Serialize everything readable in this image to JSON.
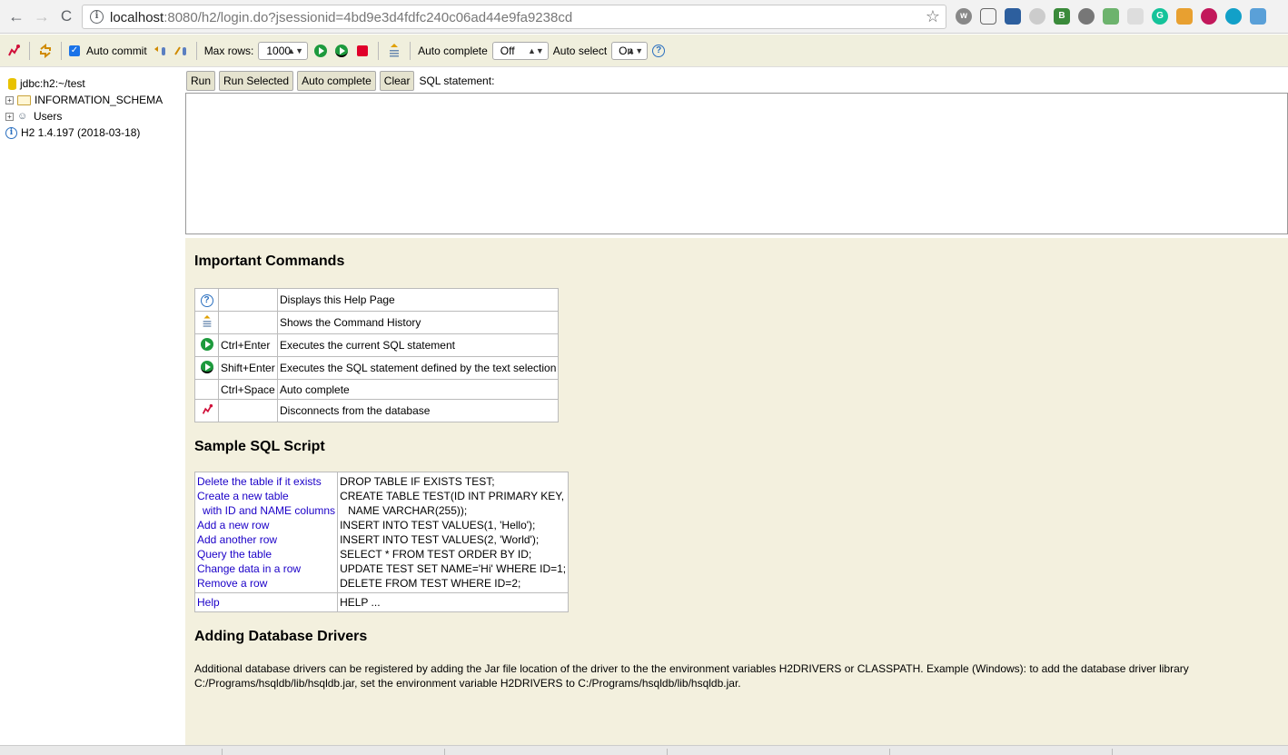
{
  "browser": {
    "url_host": "localhost",
    "url_rest": ":8080/h2/login.do?jsessionid=4bd9e3d4fdfc240c06ad44e9fa9238cd",
    "back_icon": "←",
    "forward_icon": "→",
    "reload_icon": "C",
    "star_icon": "☆"
  },
  "toolbar": {
    "auto_commit_label": "Auto commit",
    "max_rows_label": "Max rows:",
    "max_rows_value": "1000",
    "auto_complete_label": "Auto complete",
    "auto_complete_value": "Off",
    "auto_select_label": "Auto select",
    "auto_select_value": "On"
  },
  "tree": {
    "connection": "jdbc:h2:~/test",
    "schema": "INFORMATION_SCHEMA",
    "users": "Users",
    "version": "H2 1.4.197 (2018-03-18)"
  },
  "sql": {
    "run": "Run",
    "run_selected": "Run Selected",
    "auto_complete": "Auto complete",
    "clear": "Clear",
    "statement_label": "SQL statement:"
  },
  "help": {
    "important_title": "Important Commands",
    "commands": [
      {
        "key": "",
        "desc": "Displays this Help Page"
      },
      {
        "key": "",
        "desc": "Shows the Command History"
      },
      {
        "key": "Ctrl+Enter",
        "desc": "Executes the current SQL statement"
      },
      {
        "key": "Shift+Enter",
        "desc": "Executes the SQL statement defined by the text selection"
      },
      {
        "key": "Ctrl+Space",
        "desc": "Auto complete"
      },
      {
        "key": "",
        "desc": "Disconnects from the database"
      }
    ],
    "sample_title": "Sample SQL Script",
    "script_links": [
      "Delete the table if it exists",
      "Create a new table",
      "  with ID and NAME columns",
      "Add a new row",
      "Add another row",
      "Query the table",
      "Change data in a row",
      "Remove a row"
    ],
    "script_code": [
      "DROP TABLE IF EXISTS TEST;",
      "CREATE TABLE TEST(ID INT PRIMARY KEY,",
      "   NAME VARCHAR(255));",
      "INSERT INTO TEST VALUES(1, 'Hello');",
      "INSERT INTO TEST VALUES(2, 'World');",
      "SELECT * FROM TEST ORDER BY ID;",
      "UPDATE TEST SET NAME='Hi' WHERE ID=1;",
      "DELETE FROM TEST WHERE ID=2;"
    ],
    "help_link": "Help",
    "help_code": "HELP ...",
    "drivers_title": "Adding Database Drivers",
    "drivers_text": "Additional database drivers can be registered by adding the Jar file location of the driver to the the environment variables H2DRIVERS or CLASSPATH. Example (Windows): to add the database driver library C:/Programs/hsqldb/lib/hsqldb.jar, set the environment variable H2DRIVERS to C:/Programs/hsqldb/lib/hsqldb.jar."
  }
}
